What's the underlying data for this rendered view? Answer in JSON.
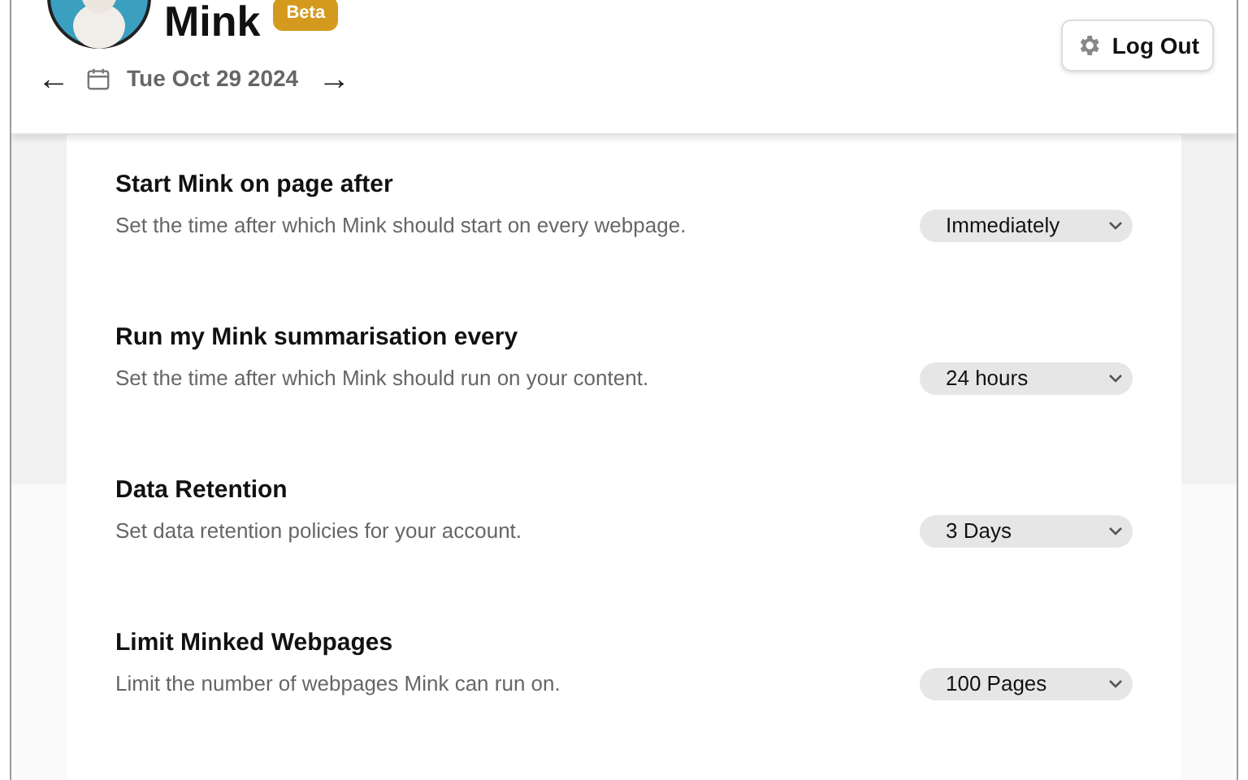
{
  "app": {
    "name": "Mink",
    "badge": "Beta"
  },
  "date_nav": {
    "prev": "←",
    "date": "Tue Oct 29 2024",
    "next": "→"
  },
  "logout_button": {
    "label": "Log Out"
  },
  "settings": [
    {
      "title": "Start Mink on page after",
      "description": "Set the time after which Mink should start on every webpage.",
      "value": "Immediately"
    },
    {
      "title": "Run my Mink summarisation every",
      "description": "Set the time after which Mink should run on your content.",
      "value": "24 hours"
    },
    {
      "title": "Data Retention",
      "description": "Set data retention policies for your account.",
      "value": "3 Days"
    },
    {
      "title": "Limit Minked Webpages",
      "description": "Limit the number of webpages Mink can run on.",
      "value": "100 Pages"
    }
  ]
}
